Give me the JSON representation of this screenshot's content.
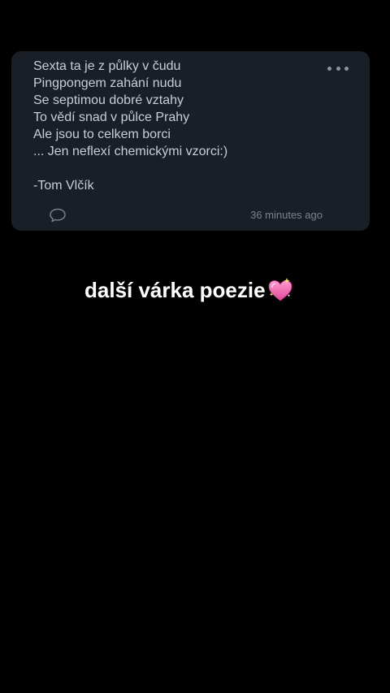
{
  "post": {
    "lines": [
      "Sexta ta je z půlky v čudu",
      "Pingpongem zahání nudu",
      "Se septimou dobré vztahy",
      "To vědí snad v půlce Prahy",
      "Ale jsou to celkem borci",
      "... Jen neflexí chemickými vzorci:)"
    ],
    "signature": "-Tom Vlčík",
    "timestamp": "36 minutes ago",
    "more_icon": "more-dots-icon",
    "comment_icon": "comment-bubble-icon"
  },
  "caption": {
    "text": "další várka poezie",
    "emoji_icon": "sparkling-heart-icon"
  },
  "colors": {
    "background": "#000000",
    "card": "#1a1f27",
    "poem_text": "#c9ced6",
    "muted": "#7a818b",
    "caption_text": "#ffffff",
    "heart": "#f06fae"
  }
}
